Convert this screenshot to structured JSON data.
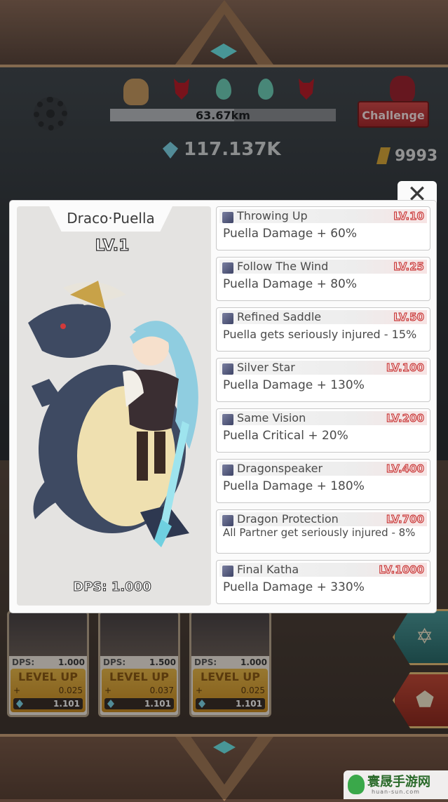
{
  "hud": {
    "distance": "63.67km",
    "distance_progress": 0.55,
    "diamonds": "117.137K",
    "gold": "9993",
    "challenge_label": "Challenge"
  },
  "cards": [
    {
      "dps_label": "DPS:",
      "dps_value": "1.000",
      "level_up_label": "LEVEL UP",
      "cost_value": "0.025",
      "diamond_value": "1.101"
    },
    {
      "dps_label": "DPS:",
      "dps_value": "1.500",
      "level_up_label": "LEVEL UP",
      "cost_value": "0.037",
      "diamond_value": "1.101"
    },
    {
      "dps_label": "DPS:",
      "dps_value": "1.000",
      "level_up_label": "LEVEL UP",
      "cost_value": "0.025",
      "diamond_value": "1.101"
    }
  ],
  "dialog": {
    "close_label": "✕",
    "character": {
      "name": "Draco·Puella",
      "level": "LV.1",
      "dps": "DPS: 1.000"
    },
    "skills": [
      {
        "title": "Throwing Up",
        "level": "LV.10",
        "desc": "Puella Damage + 60%",
        "icon": "throwing-icon"
      },
      {
        "title": "Follow The Wind",
        "level": "LV.25",
        "desc": "Puella Damage + 80%",
        "icon": "wind-icon"
      },
      {
        "title": "Refined Saddle",
        "level": "LV.50",
        "desc": "Puella gets seriously injured - 15%",
        "icon": "saddle-icon"
      },
      {
        "title": "Silver Star",
        "level": "LV.100",
        "desc": "Puella Damage + 130%",
        "icon": "star-icon"
      },
      {
        "title": "Same Vision",
        "level": "LV.200",
        "desc": "Puella Critical + 20%",
        "icon": "vision-icon"
      },
      {
        "title": "Dragonspeaker",
        "level": "LV.400",
        "desc": "Puella Damage + 180%",
        "icon": "dragon-icon"
      },
      {
        "title": "Dragon Protection",
        "level": "LV.700",
        "desc": "All Partner get seriously injured - 8%",
        "icon": "shield-icon"
      },
      {
        "title": "Final Katha",
        "level": "LV.1000",
        "desc": "Puella Damage + 330%",
        "icon": "katha-icon"
      }
    ]
  },
  "watermark": {
    "title": "寰晟手游网",
    "url": "huan-sun.com"
  }
}
